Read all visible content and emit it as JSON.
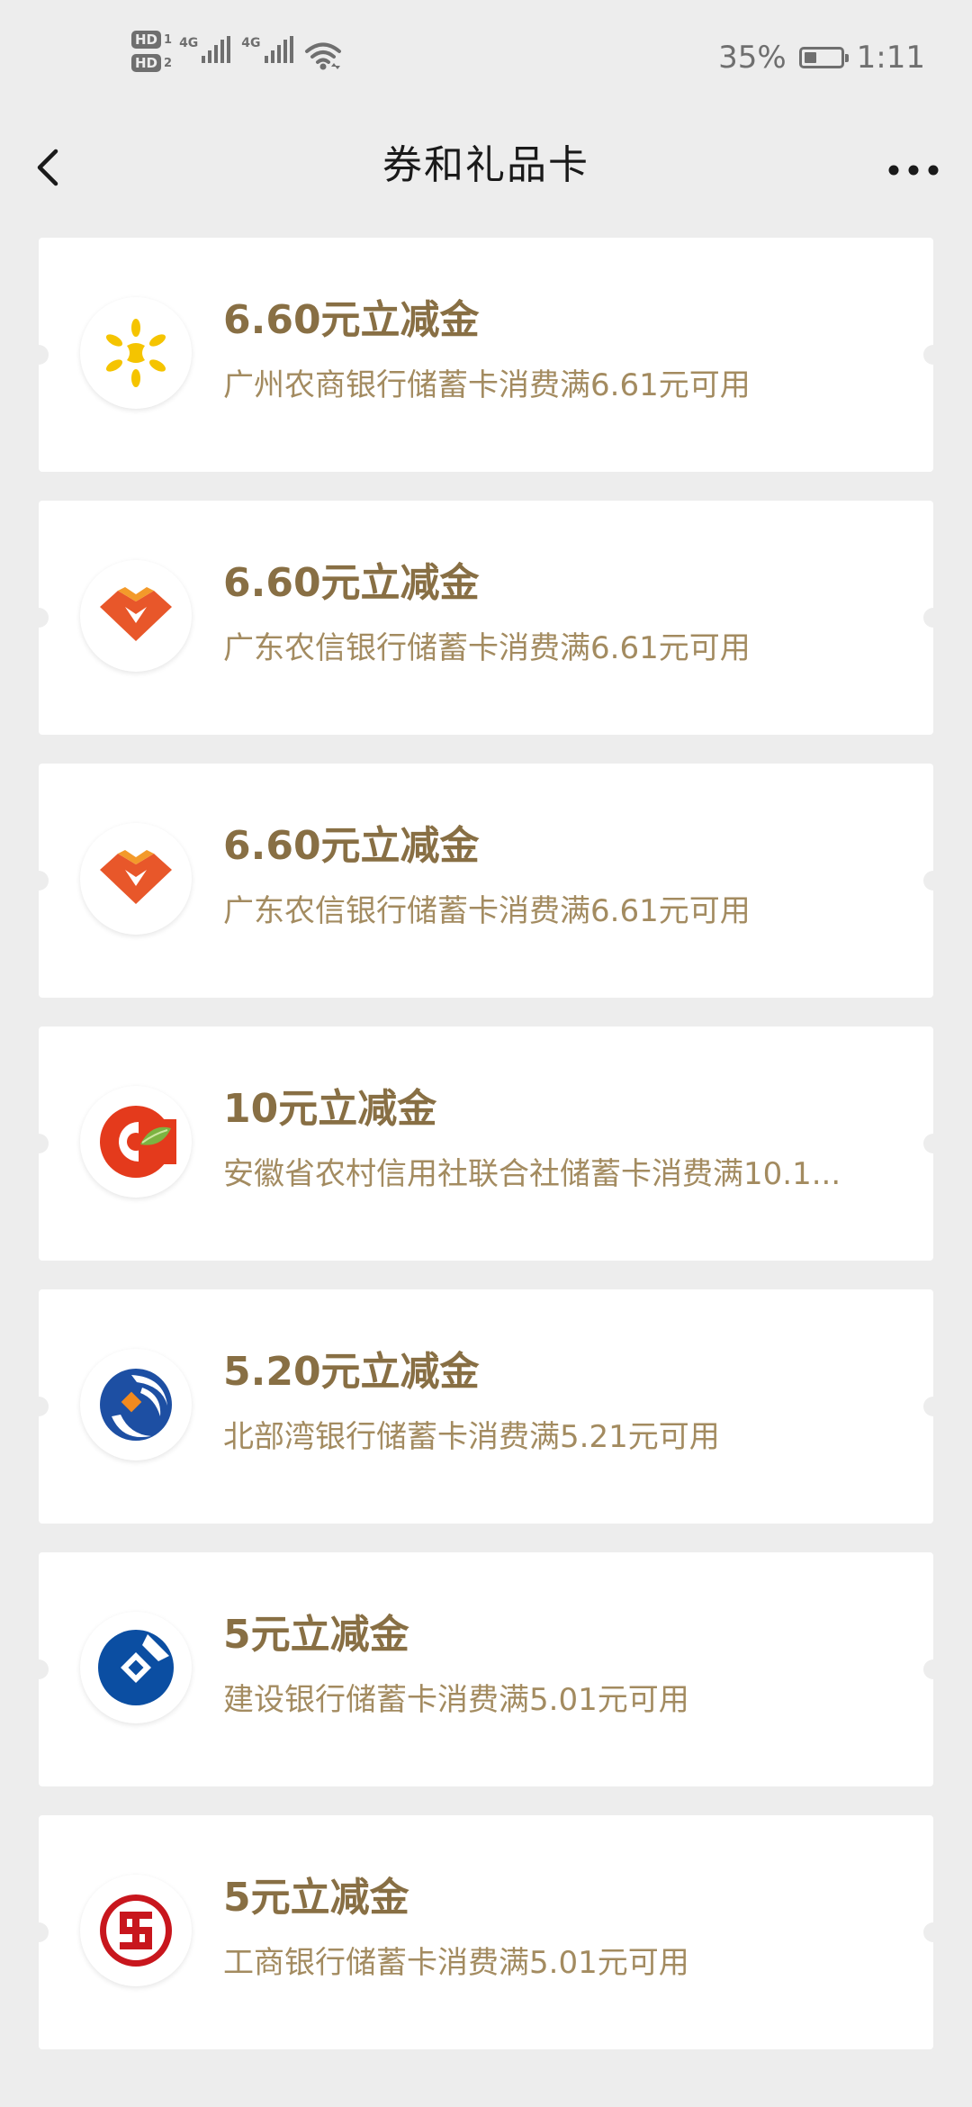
{
  "status_bar": {
    "hd1": "HD",
    "hd1_sub": "1",
    "hd2": "HD",
    "hd2_sub": "2",
    "net1": "4G",
    "net2": "4G",
    "battery_percent": "35%",
    "battery_level": 0.35,
    "time": "1:11"
  },
  "nav": {
    "title": "券和礼品卡",
    "back_icon": "chevron-left-icon",
    "more_icon": "more-dots-icon"
  },
  "colors": {
    "background": "#ededed",
    "card": "#ffffff",
    "title_gold": "#886f44",
    "desc_gold": "#a38b60"
  },
  "coupons": [
    {
      "title": "6.60元立减金",
      "desc": "广州农商银行储蓄卡消费满6.61元可用",
      "logo": "grcb-logo"
    },
    {
      "title": "6.60元立减金",
      "desc": "广东农信银行储蓄卡消费满6.61元可用",
      "logo": "gdrcu-logo"
    },
    {
      "title": "6.60元立减金",
      "desc": "广东农信银行储蓄卡消费满6.61元可用",
      "logo": "gdrcu-logo"
    },
    {
      "title": "10元立减金",
      "desc": "安徽省农村信用社联合社储蓄卡消费满10.1...",
      "logo": "ahrcu-logo"
    },
    {
      "title": "5.20元立减金",
      "desc": "北部湾银行储蓄卡消费满5.21元可用",
      "logo": "bbw-bank-logo"
    },
    {
      "title": "5元立减金",
      "desc": "建设银行储蓄卡消费满5.01元可用",
      "logo": "ccb-logo"
    },
    {
      "title": "5元立减金",
      "desc": "工商银行储蓄卡消费满5.01元可用",
      "logo": "icbc-logo"
    }
  ]
}
